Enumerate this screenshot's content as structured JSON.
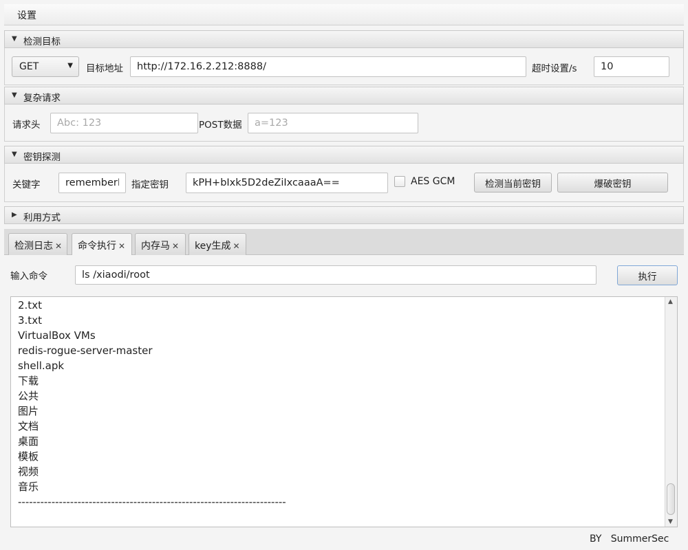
{
  "menubar": {
    "settings": "设置"
  },
  "sections": {
    "target": {
      "title": "检测目标",
      "expanded": true
    },
    "complex": {
      "title": "复杂请求",
      "expanded": true
    },
    "key": {
      "title": "密钥探测",
      "expanded": true
    },
    "exploit": {
      "title": "利用方式",
      "expanded": false
    }
  },
  "target": {
    "method": "GET",
    "url_label": "目标地址",
    "url_value": "http://172.16.2.212:8888/",
    "timeout_label": "超时设置/s",
    "timeout_value": "10"
  },
  "complex": {
    "header_label": "请求头",
    "header_placeholder": "Abc: 123",
    "post_label": "POST数据",
    "post_placeholder": "a=123"
  },
  "key": {
    "keyword_label": "关键字",
    "keyword_value": "rememberMe",
    "secret_label": "指定密钥",
    "secret_value": "kPH+bIxk5D2deZiIxcaaaA==",
    "aes_gcm_label": "AES GCM",
    "aes_gcm_checked": false,
    "check_button": "检测当前密钥",
    "brute_button": "爆破密钥"
  },
  "tabs": [
    {
      "label": "检测日志",
      "active": false
    },
    {
      "label": "命令执行",
      "active": true
    },
    {
      "label": "内存马",
      "active": false
    },
    {
      "label": "key生成",
      "active": false
    }
  ],
  "command": {
    "label": "输入命令",
    "value": "ls /xiaodi/root",
    "execute_button": "执行"
  },
  "output_lines": [
    "2.txt",
    "3.txt",
    "VirtualBox VMs",
    "redis-rogue-server-master",
    "shell.apk",
    "下载",
    "公共",
    "图片",
    "文档",
    "桌面",
    "模板",
    "视频",
    "音乐",
    "------------------------------------------------------------------------"
  ],
  "footer": "BY   SummerSec"
}
